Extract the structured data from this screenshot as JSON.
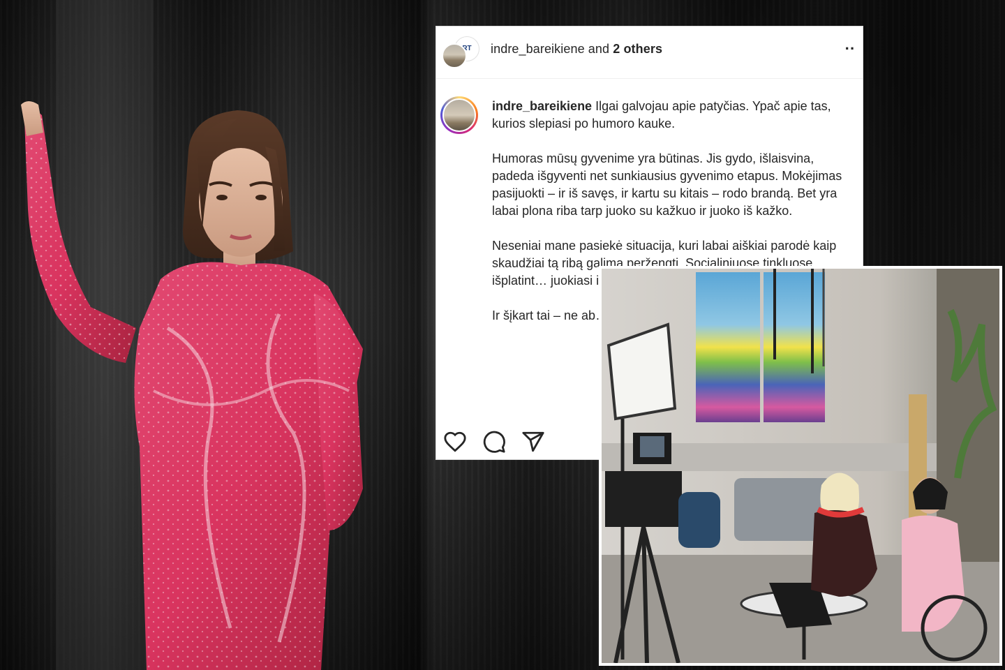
{
  "post": {
    "header": {
      "username": "indre_bareikiene",
      "and_text": " and ",
      "others": "2 others",
      "back_avatar_text": "RT",
      "more_icon": "more-dots-icon"
    },
    "caption": {
      "username": "indre_bareikiene",
      "paragraphs": [
        " Ilgai galvojau apie patyčias. Ypač apie tas, kurios slepiasi po humoro kauke.",
        "Humoras mūsų gyvenime yra būtinas. Jis gydo, išlaisvina, padeda išgyventi net sunkiausius gyvenimo etapus. Mokėjimas pasijuokti – ir iš savęs, ir kartu su kitais – rodo brandą. Bet yra labai plona riba tarp juoko su kažkuo ir juoko iš kažko.",
        "Neseniai mane pasiekė situacija, kuri labai aiškiai parodė kaip skaudžiai tą ribą galima peržengti. Socialiniuose tinkluose išplatint… juokiasi iš žmonių… jų. Ne humoro for…",
        "Ir šįkart tai – ne ab… buvo juokiamasi. … per LRT Plius kartu…"
      ]
    },
    "actions": [
      {
        "name": "like",
        "icon": "heart-icon"
      },
      {
        "name": "comment",
        "icon": "comment-bubble-icon"
      },
      {
        "name": "share",
        "icon": "paper-plane-icon"
      }
    ]
  },
  "photos": {
    "portrait": "woman-in-pink-sequin-dress",
    "studio": "tv-studio-interview"
  },
  "colors": {
    "dress": "#d9345f",
    "ig_text": "#262626",
    "ig_border": "#dbdbdb",
    "background": "#1c1c1c"
  }
}
